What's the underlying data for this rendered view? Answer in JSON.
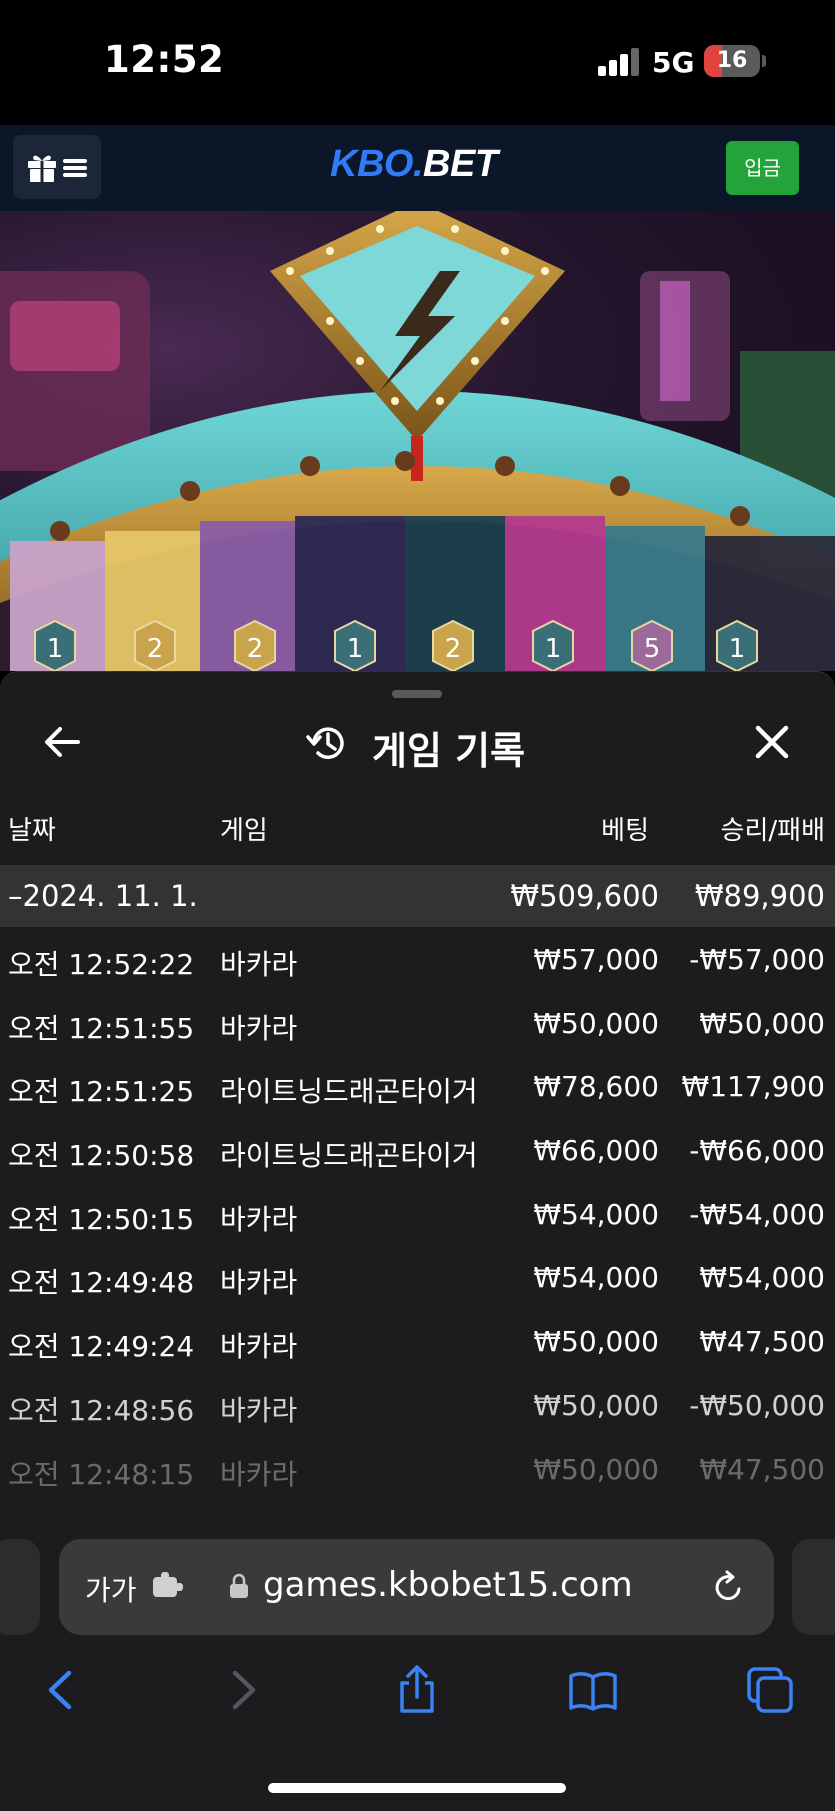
{
  "status_bar": {
    "time": "12:52",
    "network": "5G",
    "battery": "16"
  },
  "header": {
    "logo_left": "KBO.",
    "logo_right": "BET",
    "deposit_label": "입금",
    "brand_color": "#2f7cf6",
    "deposit_color": "#23a33a",
    "icons": [
      "gift-icon",
      "hamburger-icon"
    ]
  },
  "game_view": {
    "segment_labels": [
      "1",
      "2",
      "2",
      "1",
      "2",
      "1",
      "5",
      "1"
    ]
  },
  "sheet": {
    "title": "게임 기록",
    "icons": [
      "back-arrow-icon",
      "history-icon",
      "close-icon"
    ],
    "columns": {
      "date": "날짜",
      "game": "게임",
      "bet": "베팅",
      "result": "승리/패배"
    },
    "summary": {
      "date": "–2024. 11. 1.",
      "bet": "₩509,600",
      "result": "₩89,900"
    },
    "rows": [
      {
        "time": "오전 12:52:22",
        "game": "바카라",
        "bet": "₩57,000",
        "result": "-₩57,000"
      },
      {
        "time": "오전 12:51:55",
        "game": "바카라",
        "bet": "₩50,000",
        "result": "₩50,000"
      },
      {
        "time": "오전 12:51:25",
        "game": "라이트닝드래곤타이거",
        "bet": "₩78,600",
        "result": "₩117,900"
      },
      {
        "time": "오전 12:50:58",
        "game": "라이트닝드래곤타이거",
        "bet": "₩66,000",
        "result": "-₩66,000"
      },
      {
        "time": "오전 12:50:15",
        "game": "바카라",
        "bet": "₩54,000",
        "result": "-₩54,000"
      },
      {
        "time": "오전 12:49:48",
        "game": "바카라",
        "bet": "₩54,000",
        "result": "₩54,000"
      },
      {
        "time": "오전 12:49:24",
        "game": "바카라",
        "bet": "₩50,000",
        "result": "₩47,500"
      },
      {
        "time": "오전 12:48:56",
        "game": "바카라",
        "bet": "₩50,000",
        "result": "-₩50,000"
      },
      {
        "time": "오전 12:48:15",
        "game": "바카라",
        "bet": "₩50,000",
        "result": "₩47,500"
      }
    ]
  },
  "browser": {
    "aa_label": "가가",
    "url": "games.kbobet15.com",
    "accent_color": "#3b82f6",
    "icons": [
      "extension-icon",
      "lock-icon",
      "reload-icon",
      "back-icon",
      "forward-icon",
      "share-icon",
      "bookmarks-icon",
      "tabs-icon"
    ]
  }
}
